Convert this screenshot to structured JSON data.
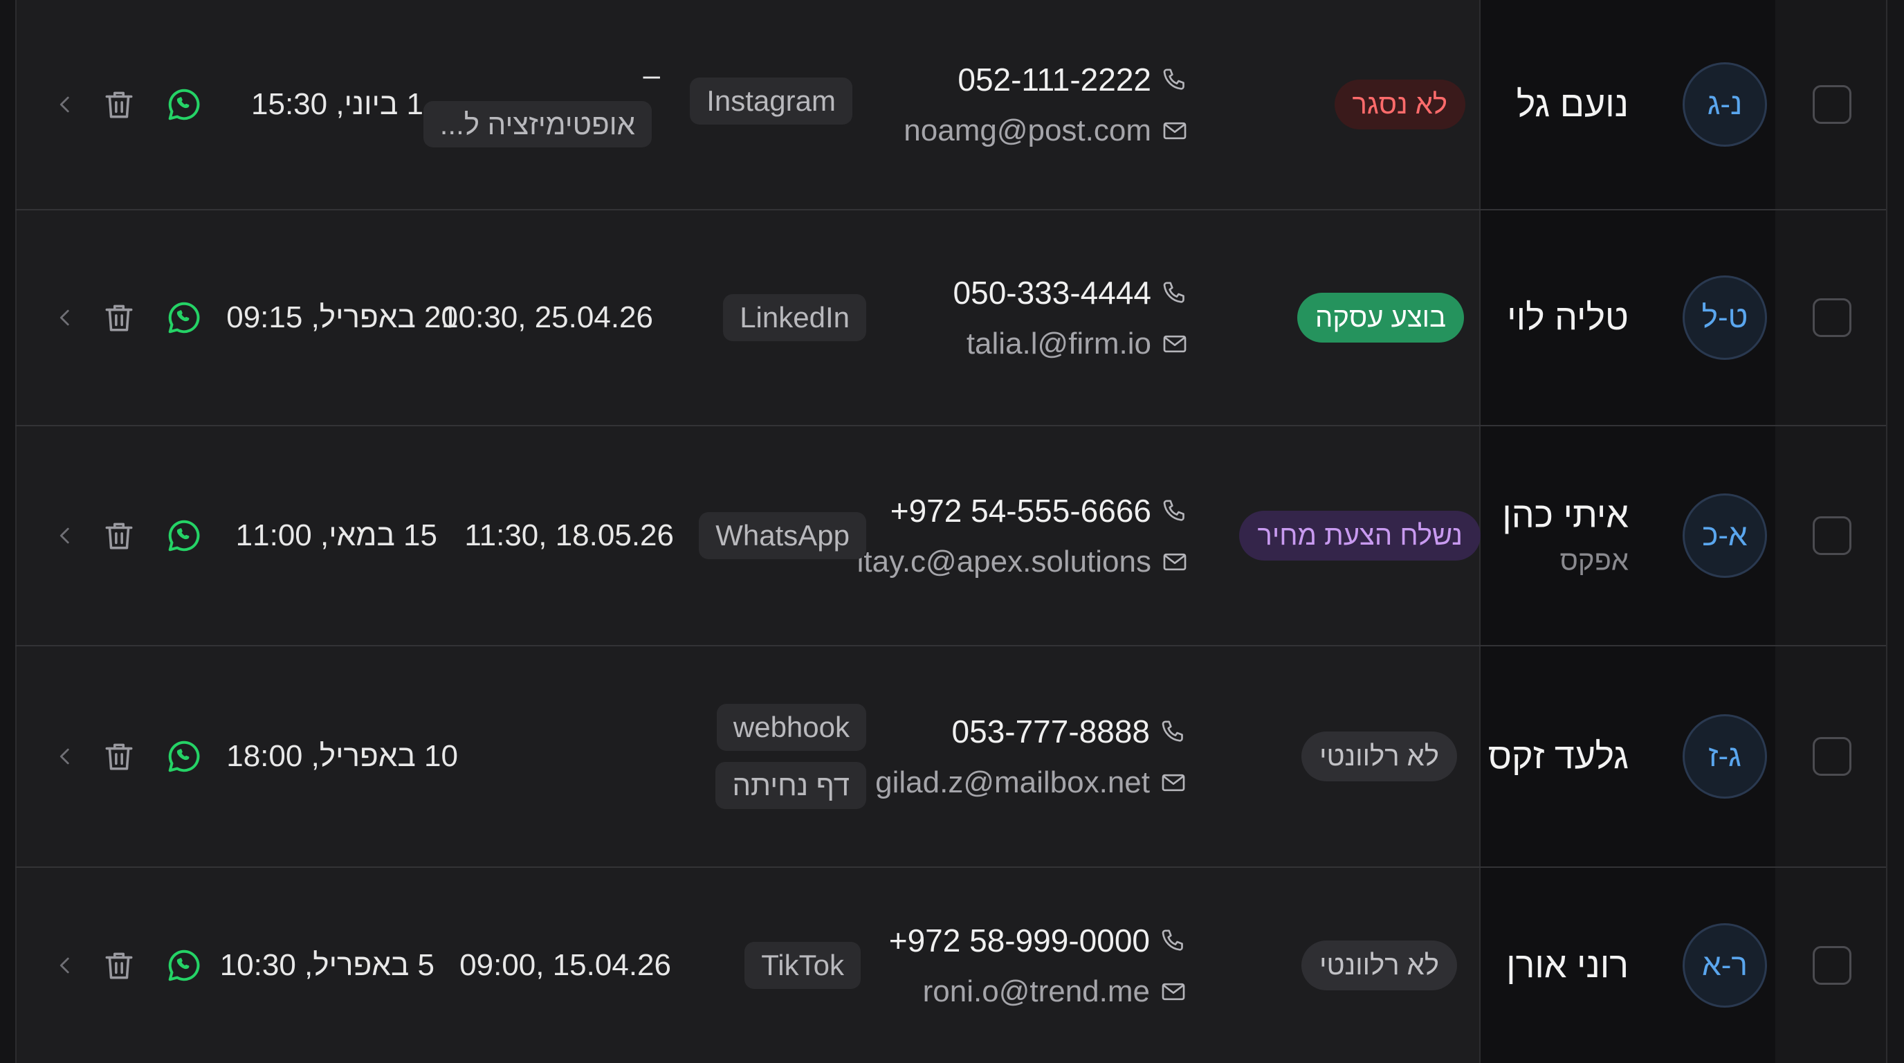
{
  "rows": [
    {
      "avatar": "נ-ג",
      "name": "נועם גל",
      "company": "",
      "status": "לא נסגר",
      "phone": "052-111-2222",
      "email": "noamg@post.com",
      "sources": [
        "Instagram"
      ],
      "source_truncated": "...אופטימיזציה ל",
      "last_contact": "–",
      "created": "1 ביוני, 15:30"
    },
    {
      "avatar": "ט-ל",
      "name": "טליה לוי",
      "company": "",
      "status": "בוצע עסקה",
      "phone": "050-333-4444",
      "email": "talia.l@firm.io",
      "sources": [
        "LinkedIn"
      ],
      "last_contact": "10:30, 25.04.26",
      "created": "20 באפריל, 09:15"
    },
    {
      "avatar": "א-כ",
      "name": "איתי כהן",
      "company": "אפקס",
      "status": "נשלח הצעת מחיר",
      "phone": "+972 54-555-6666",
      "email": "itay.c@apex.solutions",
      "sources": [
        "WhatsApp"
      ],
      "last_contact": "11:30, 18.05.26",
      "created": "15 במאי, 11:00"
    },
    {
      "avatar": "ג-ז",
      "name": "גלעד זקס",
      "company": "",
      "status": "לא רלוונטי",
      "phone": "053-777-8888",
      "email": "gilad.z@mailbox.net",
      "sources": [
        "webhook",
        "דף נחיתה"
      ],
      "last_contact": "",
      "created": "10 באפריל, 18:00"
    },
    {
      "avatar": "ר-א",
      "name": "רוני אורן",
      "company": "",
      "status": "לא רלוונטי",
      "phone": "+972 58-999-0000",
      "email": "roni.o@trend.me",
      "sources": [
        "TikTok"
      ],
      "last_contact": "09:00, 15.04.26",
      "created": "5 באפריל, 10:30"
    }
  ],
  "icons": {
    "phone": "phone-icon",
    "email": "mail-icon",
    "whatsapp": "whatsapp-icon",
    "delete": "trash-icon",
    "expand": "chevron-left-icon"
  },
  "colors": {
    "background": "#1d1d1f",
    "whatsapp": "#25d366",
    "status_red": "#ff6b6b",
    "status_green": "#25935d",
    "status_purple": "#c89af0",
    "avatar_text": "#5aa6ee"
  }
}
